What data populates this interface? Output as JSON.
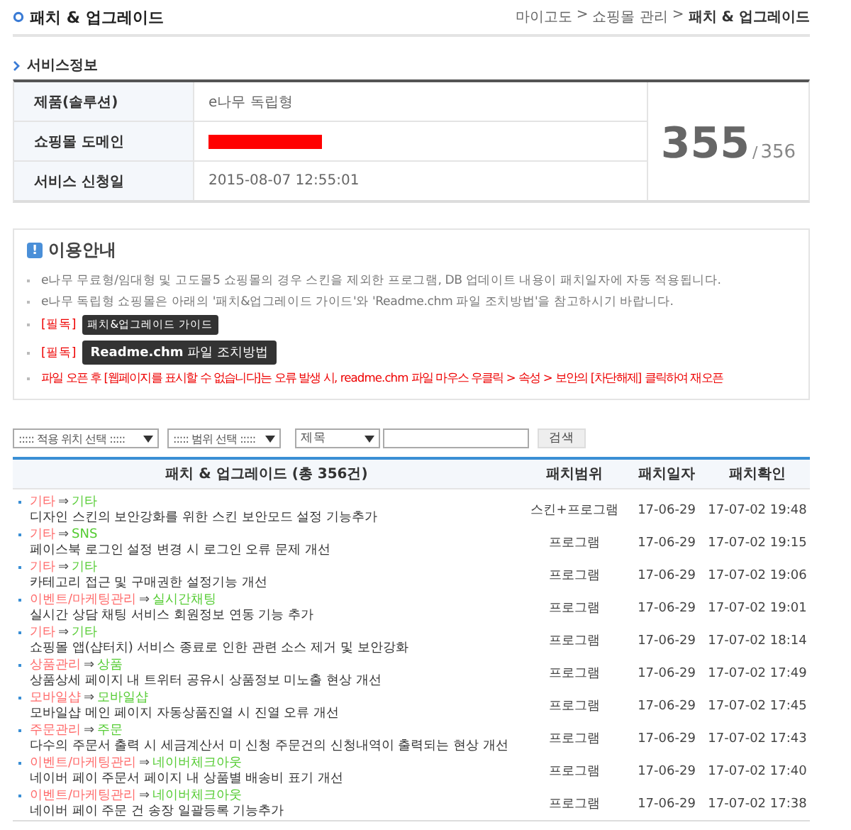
{
  "page_title": "패치 & 업그레이드",
  "breadcrumb": [
    {
      "label": "마이고도",
      "current": false
    },
    {
      "label": ">",
      "current": false
    },
    {
      "label": "쇼핑몰 관리",
      "current": false
    },
    {
      "label": ">",
      "current": false
    },
    {
      "label": "패치 & 업그레이드",
      "current": true
    }
  ],
  "service_info": {
    "title": "서비스정보",
    "rows": [
      {
        "label": "제품(솔루션)",
        "kind": "text",
        "value": "e나무 독립형"
      },
      {
        "label": "쇼핑몰 도메인",
        "kind": "redacted"
      },
      {
        "label": "서비스 신청일",
        "kind": "text",
        "value": "2015-08-07 12:55:01"
      }
    ],
    "count": "355",
    "separator": "/",
    "total": "356"
  },
  "guide": {
    "title": "이용안내",
    "icon": "!",
    "items": [
      {
        "kind": "note",
        "text": "e나무 무료형/임대형 및 고도몰5 쇼핑몰의 경우 스킨을 제외한 프로그램, DB 업데이트 내용이 패치일자에 자동 적용됩니다."
      },
      {
        "kind": "note",
        "text": "e나무 독립형 쇼핑몰은 아래의 '패치&업그레이드 가이드'와 'Readme.chm 파일 조치방법'을 참고하시기 바랍니다."
      },
      {
        "kind": "must",
        "tag": "[필독]",
        "button": "패치&업그레이드 가이드",
        "large": false
      },
      {
        "kind": "must",
        "tag": "[필독]",
        "button": "**Readme.chm** 파일 조치방법",
        "large": true
      },
      {
        "kind": "warning",
        "text": "파일 오픈 후 [웹페이지를 표시할 수 없습니다]는 오류 발생 시, readme.chm 파일 마우스 우클릭 > 속성 > 보안의 [차단해제] 클릭하여 재오픈"
      }
    ]
  },
  "filters": {
    "selects": [
      "::::: 적용 위치 선택 :::::",
      "::::: 범위 선택 :::::",
      "제목"
    ],
    "search_button": "검색"
  },
  "table": {
    "columns": [
      "패치 & 업그레이드 (총 356건)",
      "패치범위",
      "패치일자",
      "패치확인"
    ],
    "rows": [
      {
        "from": "기타",
        "arrow": "⇒",
        "to": "기타",
        "title": "디자인 스킨의 보안강화를 위한 스킨 보안모드 설정 기능추가",
        "scope": "스킨+프로그램",
        "date": "17-06-29",
        "confirmed": "17-07-02 19:48"
      },
      {
        "from": "기타",
        "arrow": "⇒",
        "to": "SNS",
        "title": "페이스북 로그인 설정 변경 시 로그인 오류 문제 개선",
        "scope": "프로그램",
        "date": "17-06-29",
        "confirmed": "17-07-02 19:15"
      },
      {
        "from": "기타",
        "arrow": "⇒",
        "to": "기타",
        "title": "카테고리 접근 및 구매권한 설정기능 개선",
        "scope": "프로그램",
        "date": "17-06-29",
        "confirmed": "17-07-02 19:06"
      },
      {
        "from": "이벤트/마케팅관리",
        "arrow": "⇒",
        "to": "실시간채팅",
        "title": "실시간 상담 채팅 서비스 회원정보 연동 기능 추가",
        "scope": "프로그램",
        "date": "17-06-29",
        "confirmed": "17-07-02 19:01"
      },
      {
        "from": "기타",
        "arrow": "⇒",
        "to": "기타",
        "title": "쇼핑몰 앱(샵터치) 서비스 종료로 인한 관련 소스 제거 및 보안강화",
        "scope": "프로그램",
        "date": "17-06-29",
        "confirmed": "17-07-02 18:14"
      },
      {
        "from": "상품관리",
        "arrow": "⇒",
        "to": "상품",
        "title": "상품상세 페이지 내 트위터 공유시 상품정보 미노출 현상 개선",
        "scope": "프로그램",
        "date": "17-06-29",
        "confirmed": "17-07-02 17:49"
      },
      {
        "from": "모바일샵",
        "arrow": "⇒",
        "to": "모바일샵",
        "title": "모바일샵 메인 페이지 자동상품진열 시 진열 오류 개선",
        "scope": "프로그램",
        "date": "17-06-29",
        "confirmed": "17-07-02 17:45"
      },
      {
        "from": "주문관리",
        "arrow": "⇒",
        "to": "주문",
        "title": "다수의 주문서 출력 시 세금계산서 미 신청 주문건의 신청내역이 출력되는 현상 개선",
        "scope": "프로그램",
        "date": "17-06-29",
        "confirmed": "17-07-02 17:43"
      },
      {
        "from": "이벤트/마케팅관리",
        "arrow": "⇒",
        "to": "네이버체크아웃",
        "title": "네이버 페이 주문서 페이지 내 상품별 배송비 표기 개선",
        "scope": "프로그램",
        "date": "17-06-29",
        "confirmed": "17-07-02 17:40"
      },
      {
        "from": "이벤트/마케팅관리",
        "arrow": "⇒",
        "to": "네이버체크아웃",
        "title": "네이버 페이 주문 건 송장 일괄등록 기능추가",
        "scope": "프로그램",
        "date": "17-06-29",
        "confirmed": "17-07-02 17:38"
      }
    ]
  }
}
